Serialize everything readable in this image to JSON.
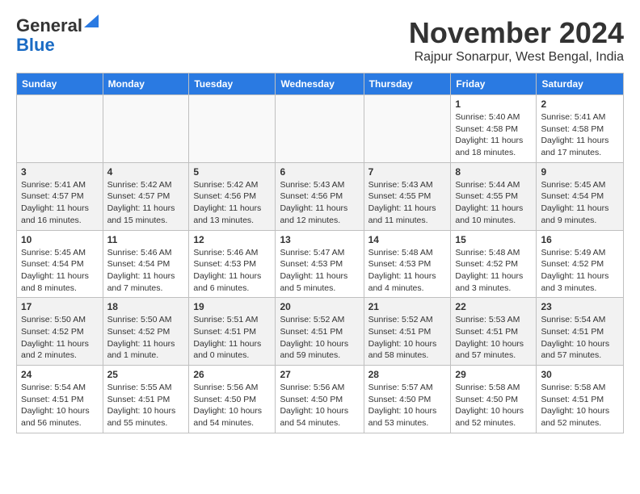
{
  "header": {
    "logo_general": "General",
    "logo_blue": "Blue",
    "month": "November 2024",
    "location": "Rajpur Sonarpur, West Bengal, India"
  },
  "weekdays": [
    "Sunday",
    "Monday",
    "Tuesday",
    "Wednesday",
    "Thursday",
    "Friday",
    "Saturday"
  ],
  "weeks": [
    [
      {
        "day": "",
        "info": ""
      },
      {
        "day": "",
        "info": ""
      },
      {
        "day": "",
        "info": ""
      },
      {
        "day": "",
        "info": ""
      },
      {
        "day": "",
        "info": ""
      },
      {
        "day": "1",
        "info": "Sunrise: 5:40 AM\nSunset: 4:58 PM\nDaylight: 11 hours and 18 minutes."
      },
      {
        "day": "2",
        "info": "Sunrise: 5:41 AM\nSunset: 4:58 PM\nDaylight: 11 hours and 17 minutes."
      }
    ],
    [
      {
        "day": "3",
        "info": "Sunrise: 5:41 AM\nSunset: 4:57 PM\nDaylight: 11 hours and 16 minutes."
      },
      {
        "day": "4",
        "info": "Sunrise: 5:42 AM\nSunset: 4:57 PM\nDaylight: 11 hours and 15 minutes."
      },
      {
        "day": "5",
        "info": "Sunrise: 5:42 AM\nSunset: 4:56 PM\nDaylight: 11 hours and 13 minutes."
      },
      {
        "day": "6",
        "info": "Sunrise: 5:43 AM\nSunset: 4:56 PM\nDaylight: 11 hours and 12 minutes."
      },
      {
        "day": "7",
        "info": "Sunrise: 5:43 AM\nSunset: 4:55 PM\nDaylight: 11 hours and 11 minutes."
      },
      {
        "day": "8",
        "info": "Sunrise: 5:44 AM\nSunset: 4:55 PM\nDaylight: 11 hours and 10 minutes."
      },
      {
        "day": "9",
        "info": "Sunrise: 5:45 AM\nSunset: 4:54 PM\nDaylight: 11 hours and 9 minutes."
      }
    ],
    [
      {
        "day": "10",
        "info": "Sunrise: 5:45 AM\nSunset: 4:54 PM\nDaylight: 11 hours and 8 minutes."
      },
      {
        "day": "11",
        "info": "Sunrise: 5:46 AM\nSunset: 4:54 PM\nDaylight: 11 hours and 7 minutes."
      },
      {
        "day": "12",
        "info": "Sunrise: 5:46 AM\nSunset: 4:53 PM\nDaylight: 11 hours and 6 minutes."
      },
      {
        "day": "13",
        "info": "Sunrise: 5:47 AM\nSunset: 4:53 PM\nDaylight: 11 hours and 5 minutes."
      },
      {
        "day": "14",
        "info": "Sunrise: 5:48 AM\nSunset: 4:53 PM\nDaylight: 11 hours and 4 minutes."
      },
      {
        "day": "15",
        "info": "Sunrise: 5:48 AM\nSunset: 4:52 PM\nDaylight: 11 hours and 3 minutes."
      },
      {
        "day": "16",
        "info": "Sunrise: 5:49 AM\nSunset: 4:52 PM\nDaylight: 11 hours and 3 minutes."
      }
    ],
    [
      {
        "day": "17",
        "info": "Sunrise: 5:50 AM\nSunset: 4:52 PM\nDaylight: 11 hours and 2 minutes."
      },
      {
        "day": "18",
        "info": "Sunrise: 5:50 AM\nSunset: 4:52 PM\nDaylight: 11 hours and 1 minute."
      },
      {
        "day": "19",
        "info": "Sunrise: 5:51 AM\nSunset: 4:51 PM\nDaylight: 11 hours and 0 minutes."
      },
      {
        "day": "20",
        "info": "Sunrise: 5:52 AM\nSunset: 4:51 PM\nDaylight: 10 hours and 59 minutes."
      },
      {
        "day": "21",
        "info": "Sunrise: 5:52 AM\nSunset: 4:51 PM\nDaylight: 10 hours and 58 minutes."
      },
      {
        "day": "22",
        "info": "Sunrise: 5:53 AM\nSunset: 4:51 PM\nDaylight: 10 hours and 57 minutes."
      },
      {
        "day": "23",
        "info": "Sunrise: 5:54 AM\nSunset: 4:51 PM\nDaylight: 10 hours and 57 minutes."
      }
    ],
    [
      {
        "day": "24",
        "info": "Sunrise: 5:54 AM\nSunset: 4:51 PM\nDaylight: 10 hours and 56 minutes."
      },
      {
        "day": "25",
        "info": "Sunrise: 5:55 AM\nSunset: 4:51 PM\nDaylight: 10 hours and 55 minutes."
      },
      {
        "day": "26",
        "info": "Sunrise: 5:56 AM\nSunset: 4:50 PM\nDaylight: 10 hours and 54 minutes."
      },
      {
        "day": "27",
        "info": "Sunrise: 5:56 AM\nSunset: 4:50 PM\nDaylight: 10 hours and 54 minutes."
      },
      {
        "day": "28",
        "info": "Sunrise: 5:57 AM\nSunset: 4:50 PM\nDaylight: 10 hours and 53 minutes."
      },
      {
        "day": "29",
        "info": "Sunrise: 5:58 AM\nSunset: 4:50 PM\nDaylight: 10 hours and 52 minutes."
      },
      {
        "day": "30",
        "info": "Sunrise: 5:58 AM\nSunset: 4:51 PM\nDaylight: 10 hours and 52 minutes."
      }
    ]
  ]
}
